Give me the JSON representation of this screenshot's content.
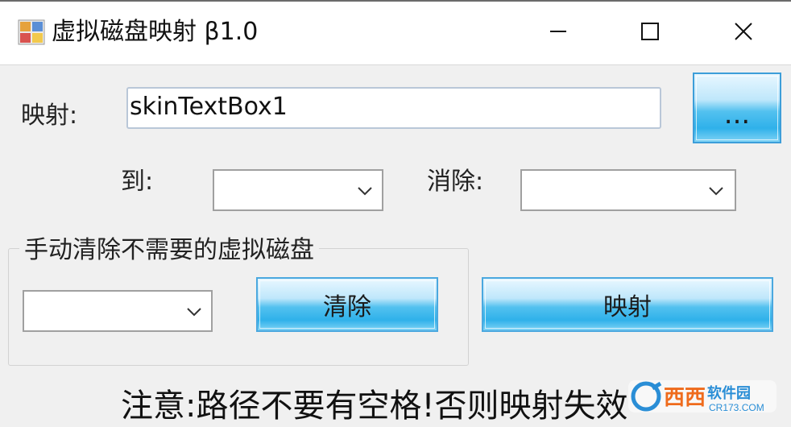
{
  "window": {
    "title": "虚拟磁盘映射  β1.0",
    "minimize_icon": "minimize-icon",
    "maximize_icon": "maximize-icon",
    "close_icon": "close-icon"
  },
  "map": {
    "label": "映射:",
    "textbox_value": "skinTextBox1",
    "browse_label": "..."
  },
  "to": {
    "label": "到:",
    "selected": ""
  },
  "remove": {
    "label": "消除:",
    "selected": ""
  },
  "group": {
    "title": "手动清除不需要的虚拟磁盘",
    "combo_selected": "",
    "clear_label": "清除"
  },
  "map_button_label": "映射",
  "note": "注意:路径不要有空格!否则映射失效",
  "watermark": {
    "text": "西西",
    "sub": "软件园",
    "url": "CR173.COM"
  },
  "colors": {
    "button_border": "#4aa8df",
    "button_fill": "#2fb1ea",
    "titlebar": "#ffffff",
    "background": "#f0f0f0"
  }
}
